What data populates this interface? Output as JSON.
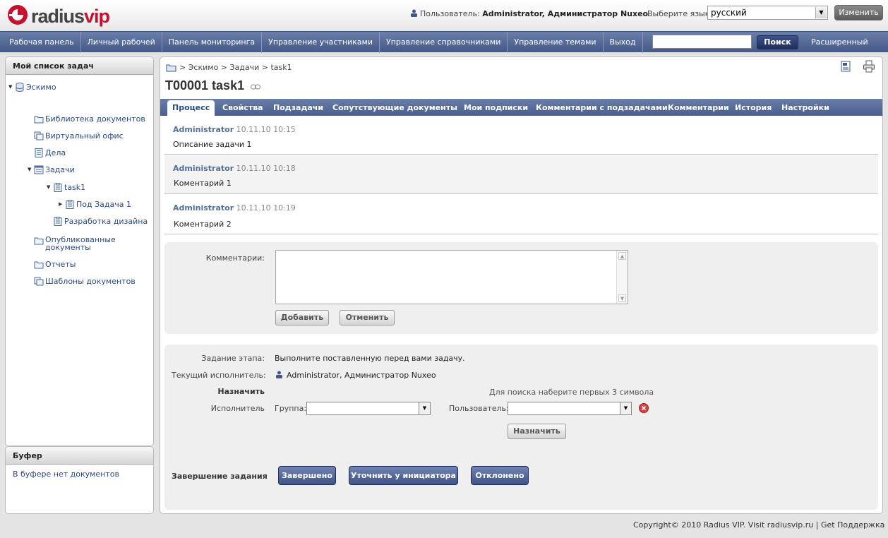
{
  "header": {
    "brand_left": "radius",
    "brand_right": "vip",
    "user_label": "Пользователь:",
    "user_name": "Administrator, Администратор Nuxeo",
    "lang_label": "Выберите язык:",
    "lang_value": "русский",
    "change_button": "Изменить"
  },
  "nav": {
    "items": [
      "Рабочая панель",
      "Личный рабочей",
      "Панель мониторинга",
      "Управление участниками",
      "Управление справочниками",
      "Управление темами",
      "Выход"
    ],
    "search_button": "Поиск",
    "advanced_search": "Расширенный поиск"
  },
  "sidebar": {
    "title": "Мой список задач",
    "tree": [
      {
        "label": "Эскимо"
      },
      {
        "label": "Библиотека документов"
      },
      {
        "label": "Виртуальный офис"
      },
      {
        "label": "Дела"
      },
      {
        "label": "Задачи"
      },
      {
        "label": "task1"
      },
      {
        "label": "Под Задача 1"
      },
      {
        "label": "Разработка дизайна"
      },
      {
        "label": "Опубликованные\nдокументы"
      },
      {
        "label": "Отчеты"
      },
      {
        "label": "Шаблоны документов"
      }
    ],
    "buffer_title": "Буфер",
    "buffer_empty": "В буфере нет документов"
  },
  "main": {
    "breadcrumb": "> Эскимо > Задачи > task1",
    "title": "T00001 task1",
    "tabs": [
      "Процесс",
      "Свойства",
      "Подзадачи",
      "Сопутствующие документы",
      "Мои подписки",
      "Комментарии с подзадачами",
      "Комментарии",
      "История",
      "Настройки"
    ],
    "comments": [
      {
        "author": "Administrator",
        "date": "10.11.10 10:15",
        "text": "Описание задачи 1"
      },
      {
        "author": "Administrator",
        "date": "10.11.10 10:18",
        "text": "Коментарий 1"
      },
      {
        "author": "Administrator",
        "date": "10.11.10 10:19",
        "text": "Коментарий 2"
      }
    ],
    "comment_form": {
      "label": "Комментарии:",
      "add_button": "Добавить",
      "cancel_button": "Отменить"
    },
    "task": {
      "stage_label": "Задание этапа:",
      "stage_value": "Выполните поставленную перед вами задачу.",
      "executor_label": "Текущий исполнитель:",
      "executor_value": "Administrator, Администратор Nuxeo",
      "assign_heading": "Назначить",
      "search_hint": "Для поиска наберите первых 3 символа",
      "performer_label": "Исполнитель",
      "group_label": "Группа:",
      "user_label": "Пользователь:",
      "assign_button": "Назначить",
      "completion_label": "Завершение задания",
      "done_button": "Завершено",
      "clarify_button": "Уточнить у инициатора",
      "reject_button": "Отклонено"
    }
  },
  "footer": {
    "text": "Copyright© 2010 Radius VIP. Visit radiusvip.ru | Get Поддержка"
  },
  "colors": {
    "brand_red": "#c8102e",
    "nav_blue": "#4a5e90",
    "link_blue": "#2a4a86"
  }
}
